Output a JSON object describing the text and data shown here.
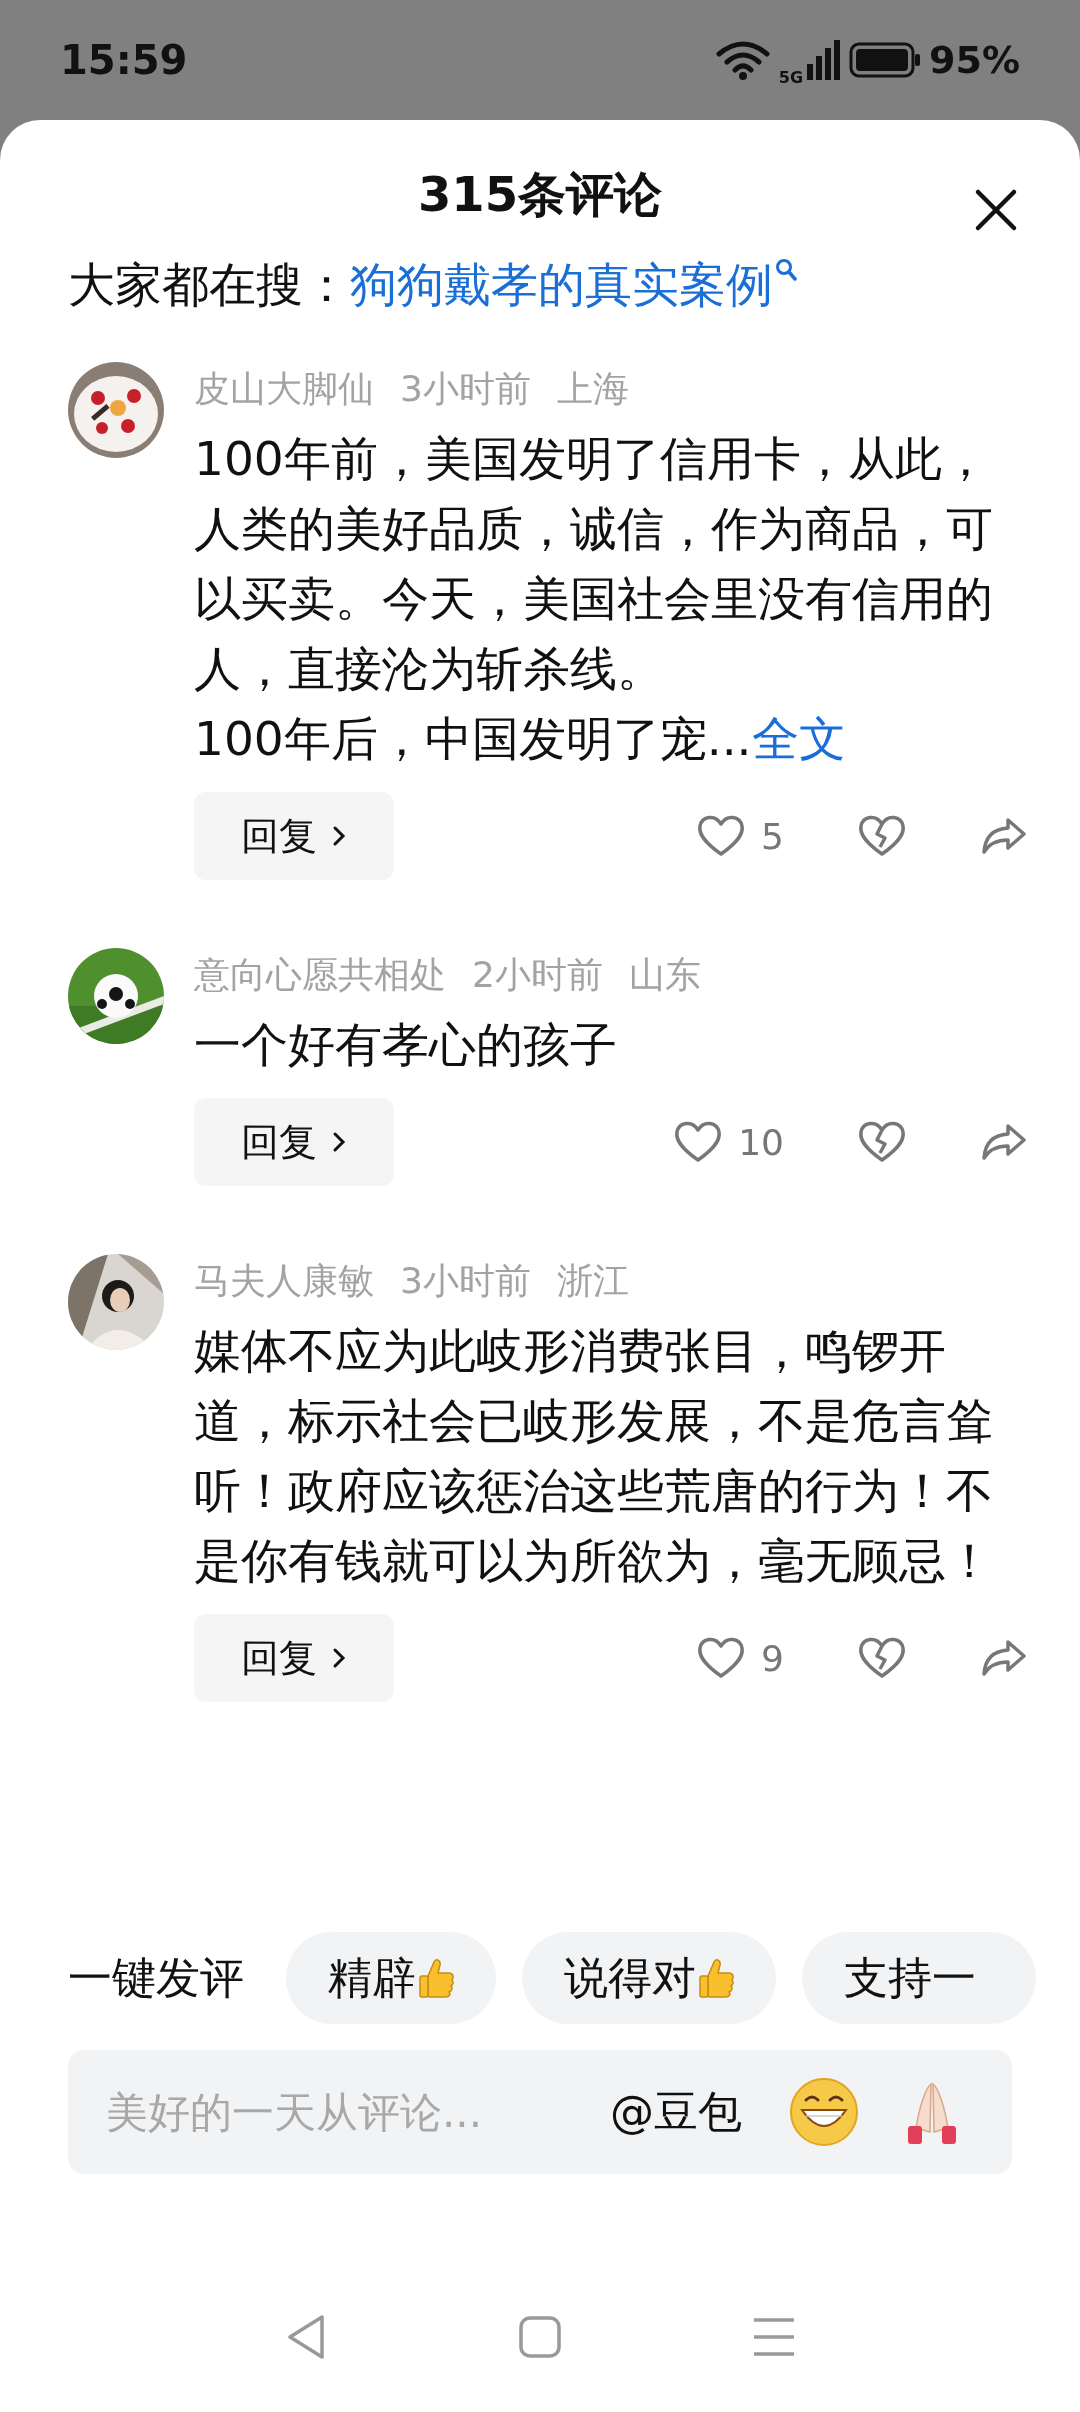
{
  "status_bar": {
    "time": "15:59",
    "network": "5G",
    "battery": "95%"
  },
  "sheet": {
    "title": "315条评论",
    "search": {
      "label": "大家都在搜：",
      "query": "狗狗戴孝的真实案例"
    }
  },
  "comments": [
    {
      "author": "皮山大脚仙",
      "time": "3小时前",
      "location": "上海",
      "text": "100年前，美国发明了信用卡，从此，人类的美好品质，诚信，作为商品，可以买卖。今天，美国社会里没有信用的人，直接沦为斩杀线。\n100年后，中国发明了宠...",
      "more_link": "全文",
      "reply": "回复",
      "likes": "5"
    },
    {
      "author": "意向心愿共相处",
      "time": "2小时前",
      "location": "山东",
      "text": "一个好有孝心的孩子",
      "reply": "回复",
      "likes": "10"
    },
    {
      "author": "马夫人康敏",
      "time": "3小时前",
      "location": "浙江",
      "text": "媒体不应为此岐形消费张目，鸣锣开道，标示社会已岐形发展，不是危言耸听！政府应该惩治这些荒唐的行为！不是你有钱就可以为所欲为，毫无顾忌！",
      "reply": "回复",
      "likes": "9"
    }
  ],
  "quick_comment": {
    "label": "一键发评",
    "chips": [
      {
        "text": "精辟",
        "kind": "thumbs"
      },
      {
        "text": "说得对",
        "kind": "thumbs"
      },
      {
        "text": "支持一",
        "kind": "plain"
      }
    ]
  },
  "input": {
    "placeholder": "美好的一天从评论...",
    "mention": "@豆包"
  }
}
